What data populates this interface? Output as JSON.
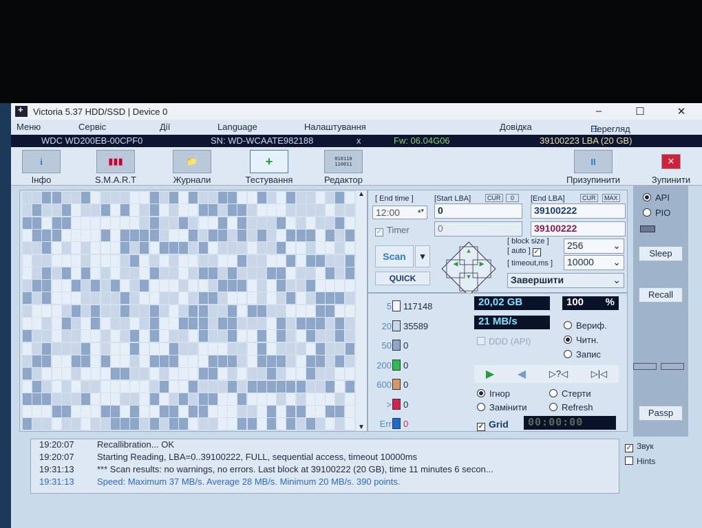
{
  "window": {
    "title": "Victoria 5.37 HDD/SSD | Device 0",
    "controls": [
      "–",
      "☐",
      "✕"
    ]
  },
  "menu": [
    "Меню",
    "Сервіс",
    "Дії",
    "Language",
    "Налаштування",
    "Довідка"
  ],
  "buffer_view": "Перегляд буфера",
  "drive": {
    "model": "WDC WD200EB-00CPF0",
    "serial": "SN: WD-WCAATE982188",
    "close": "x",
    "firmware": "Fw: 06.04G06",
    "capacity": "39100223 LBA (20 GB)"
  },
  "toolbar": [
    {
      "label": "Інфо",
      "icon": "info-icon"
    },
    {
      "label": "S.M.A.R.T",
      "icon": "test-tubes-icon"
    },
    {
      "label": "Журнали",
      "icon": "folder-icon"
    },
    {
      "label": "Тестування",
      "icon": "medkit-icon",
      "active": true
    },
    {
      "label": "Редактор",
      "icon": "binary-doc-icon"
    }
  ],
  "pause_label": "Призупинити",
  "stop_label": "Зупинити",
  "scan": {
    "end_time_label": "[ End time ]",
    "end_time": "12:00",
    "timer_label": "Timer",
    "start_lba_label": "[Start LBA]",
    "cur": "CUR",
    "zero": "0",
    "start_lba": "0",
    "start_lba2": "0",
    "end_lba_label": "[End LBA]",
    "max": "MAX",
    "end_lba": "39100222",
    "end_lba2": "39100222",
    "block_size_label": "[ block size ]",
    "auto_label": "[ auto ]",
    "timeout_label": "[ timeout,ms ]",
    "block_size": "256",
    "timeout": "10000",
    "scan_btn": "Scan",
    "quick_btn": "QUICK",
    "finish": "Завершити"
  },
  "legend": [
    {
      "ms": "5",
      "count": "117148",
      "color": "#f4f8fc"
    },
    {
      "ms": "20",
      "count": "35589",
      "color": "#c8d6e8"
    },
    {
      "ms": "50",
      "count": "0",
      "color": "#8ea6c8"
    },
    {
      "ms": "200",
      "count": "0",
      "color": "#2cc04a"
    },
    {
      "ms": "600",
      "count": "0",
      "color": "#d89a60"
    },
    {
      "ms": ">",
      "count": "0",
      "color": "#d8204a"
    },
    {
      "ms": "Err",
      "count": "0",
      "color": "#1a6ad0"
    }
  ],
  "progress": {
    "size": "20,02 GB",
    "percent": "100",
    "percent_sign": "%",
    "speed": "21 MB/s",
    "ddd": "DDD (API)",
    "percent_value": 100
  },
  "mode": {
    "options": [
      "Вериф.",
      "Читн.",
      "Запис"
    ],
    "selected": "Читн."
  },
  "action": {
    "options": [
      "Ігнор",
      "Стерти",
      "Замінити",
      "Refresh"
    ],
    "selected": "Ігнор"
  },
  "grid_label": "Grid",
  "elapsed": "00:00:00",
  "side": {
    "api": "API",
    "pio": "PIO",
    "sleep": "Sleep",
    "recall": "Recall",
    "passp": "Passp"
  },
  "log": [
    {
      "time": "19:20:07",
      "msg": "Recallibration... OK",
      "color": "#1a2a40"
    },
    {
      "time": "19:20:07",
      "msg": "Starting Reading, LBA=0..39100222, FULL, sequential access, timeout 10000ms",
      "color": "#1a2a40"
    },
    {
      "time": "19:31:13",
      "msg": "*** Scan results: no warnings, no errors. Last block at 39100222 (20 GB), time 11 minutes 6 secon...",
      "color": "#1a2a40"
    },
    {
      "time": "19:31:13",
      "msg": "Speed: Maximum 37 MB/s. Average 28 MB/s. Minimum 20 MB/s. 390 points.",
      "color": "#2a6ad0"
    }
  ],
  "sound_label": "Звук",
  "hints_label": "Hints"
}
